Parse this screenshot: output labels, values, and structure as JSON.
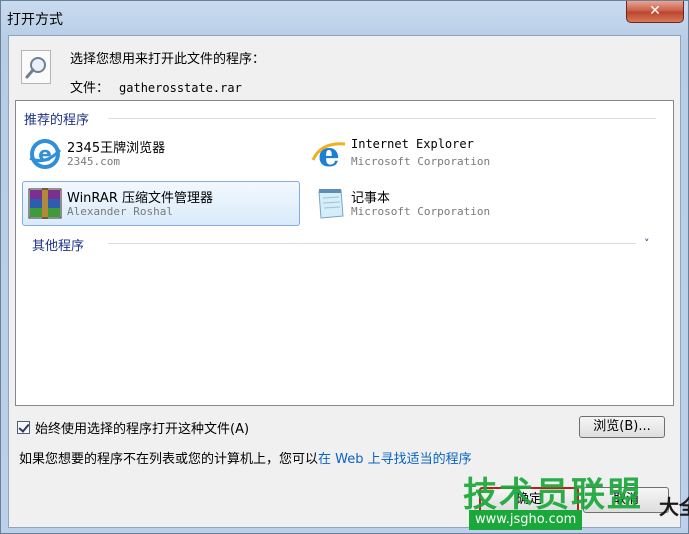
{
  "window": {
    "title": "打开方式",
    "close_glyph": "✕"
  },
  "header": {
    "prompt": "选择您想用来打开此文件的程序：",
    "file_label": "文件：",
    "file_name": "gatherosstate.rar"
  },
  "recommended": {
    "header": "推荐的程序",
    "items": [
      {
        "name": "2345王牌浏览器",
        "sub": "2345.com",
        "icon": "browser-2345-icon",
        "selected": false
      },
      {
        "name": "Internet Explorer",
        "sub": "Microsoft Corporation",
        "icon": "internet-explorer-icon",
        "selected": false
      },
      {
        "name": "WinRAR 压缩文件管理器",
        "sub": "Alexander Roshal",
        "icon": "winrar-icon",
        "selected": true
      },
      {
        "name": "记事本",
        "sub": "Microsoft Corporation",
        "icon": "notepad-icon",
        "selected": false
      }
    ]
  },
  "other": {
    "header": "其他程序",
    "expand_glyph": "˅"
  },
  "options": {
    "always_use_label": "始终使用选择的程序打开这种文件(A)",
    "always_use_checked": true,
    "browse_label": "浏览(B)...",
    "hint_text": "如果您想要的程序不在列表或您的计算机上，您可以",
    "hint_link": "在 Web 上寻找适当的程序"
  },
  "buttons": {
    "ok_label": "确定",
    "cancel_label": "取消"
  },
  "watermark": {
    "text": "技术员联盟",
    "url": "www.jsgho.com",
    "side_text": "大全"
  },
  "colors": {
    "link": "#0b63c2",
    "group_header": "#1e3287",
    "selection_border": "#84acdd",
    "ok_highlight": "#c21d1d",
    "watermark_green": "#1aa83a"
  }
}
